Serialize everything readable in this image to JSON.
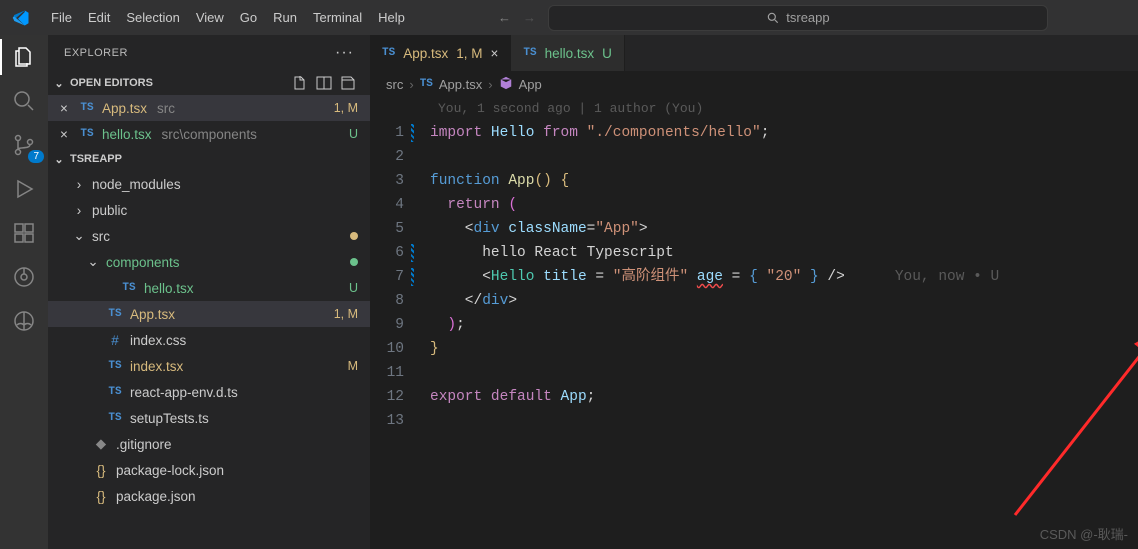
{
  "menubar": [
    "File",
    "Edit",
    "Selection",
    "View",
    "Go",
    "Run",
    "Terminal",
    "Help"
  ],
  "search": {
    "placeholder": "tsreapp"
  },
  "activity": {
    "scm_badge": "7"
  },
  "explorer": {
    "title": "EXPLORER",
    "sections": {
      "open_editors": "OPEN EDITORS",
      "project": "TSREAPP"
    },
    "open_editors": [
      {
        "name": "App.tsx",
        "extra": "src",
        "status": "1, M",
        "status_class": "git-m",
        "name_class": "git-m",
        "selected": true,
        "icon": "TS"
      },
      {
        "name": "hello.tsx",
        "extra": "src\\components",
        "status": "U",
        "status_class": "git-u",
        "name_class": "git-u",
        "icon": "TS"
      }
    ],
    "tree": [
      {
        "depth": 1,
        "kind": "folder-collapsed",
        "name": "node_modules"
      },
      {
        "depth": 1,
        "kind": "folder-collapsed",
        "name": "public"
      },
      {
        "depth": 1,
        "kind": "folder-open",
        "name": "src",
        "dot": "dot-m"
      },
      {
        "depth": 2,
        "kind": "folder-open",
        "name": "components",
        "name_class": "git-u",
        "dot": "dot-u"
      },
      {
        "depth": 3,
        "kind": "file",
        "icon": "TS",
        "name": "hello.tsx",
        "name_class": "git-u",
        "status": "U",
        "status_class": "git-u"
      },
      {
        "depth": 2,
        "kind": "file",
        "icon": "TS",
        "name": "App.tsx",
        "name_class": "git-m",
        "status": "1, M",
        "status_class": "git-m",
        "selected": true
      },
      {
        "depth": 2,
        "kind": "file",
        "icon": "#",
        "name": "index.css"
      },
      {
        "depth": 2,
        "kind": "file",
        "icon": "TS",
        "name": "index.tsx",
        "name_class": "git-m",
        "status": "M",
        "status_class": "git-m"
      },
      {
        "depth": 2,
        "kind": "file",
        "icon": "TS",
        "name": "react-app-env.d.ts"
      },
      {
        "depth": 2,
        "kind": "file",
        "icon": "TS",
        "name": "setupTests.ts"
      },
      {
        "depth": 1,
        "kind": "file",
        "icon": "gear",
        "name": ".gitignore"
      },
      {
        "depth": 1,
        "kind": "file",
        "icon": "{}",
        "name": "package-lock.json"
      },
      {
        "depth": 1,
        "kind": "file",
        "icon": "{}",
        "name": "package.json"
      }
    ]
  },
  "tabs": [
    {
      "name": "App.tsx",
      "name_class": "git-m",
      "suffix": "1, M",
      "suffix_class": "git-m",
      "icon": "TS",
      "active": true,
      "closable": true
    },
    {
      "name": "hello.tsx",
      "name_class": "git-u",
      "suffix": "U",
      "suffix_class": "git-u",
      "icon": "TS",
      "active": false
    }
  ],
  "breadcrumb": {
    "segments": [
      {
        "label": "src"
      },
      {
        "icon": "TS",
        "label": "App.tsx"
      },
      {
        "icon": "cube",
        "label": "App"
      }
    ]
  },
  "blame_top": "You, 1 second ago | 1 author (You)",
  "code_lines": [
    1,
    2,
    3,
    4,
    5,
    6,
    7,
    8,
    9,
    10,
    11,
    12,
    13
  ],
  "mod_lines": [
    1,
    6,
    7
  ],
  "code": {
    "l1": {
      "a": "import",
      "b": "Hello",
      "c": "from",
      "d": "\"./components/hello\""
    },
    "l3": {
      "a": "function",
      "b": "App",
      "c": "()"
    },
    "l4": {
      "a": "return",
      "b": "("
    },
    "l5": {
      "a": "div",
      "b": "className",
      "c": "\"App\""
    },
    "l6": "hello React Typescript",
    "l7": {
      "a": "Hello",
      "b": "title",
      "c": "\"高阶组件\"",
      "d": "age",
      "e": "\"20\""
    },
    "l7_blame": "You, now • U",
    "l8": {
      "a": "div"
    },
    "l10": "}",
    "l12": {
      "a": "export",
      "b": "default",
      "c": "App"
    }
  },
  "watermark": "CSDN @-耿瑞-"
}
